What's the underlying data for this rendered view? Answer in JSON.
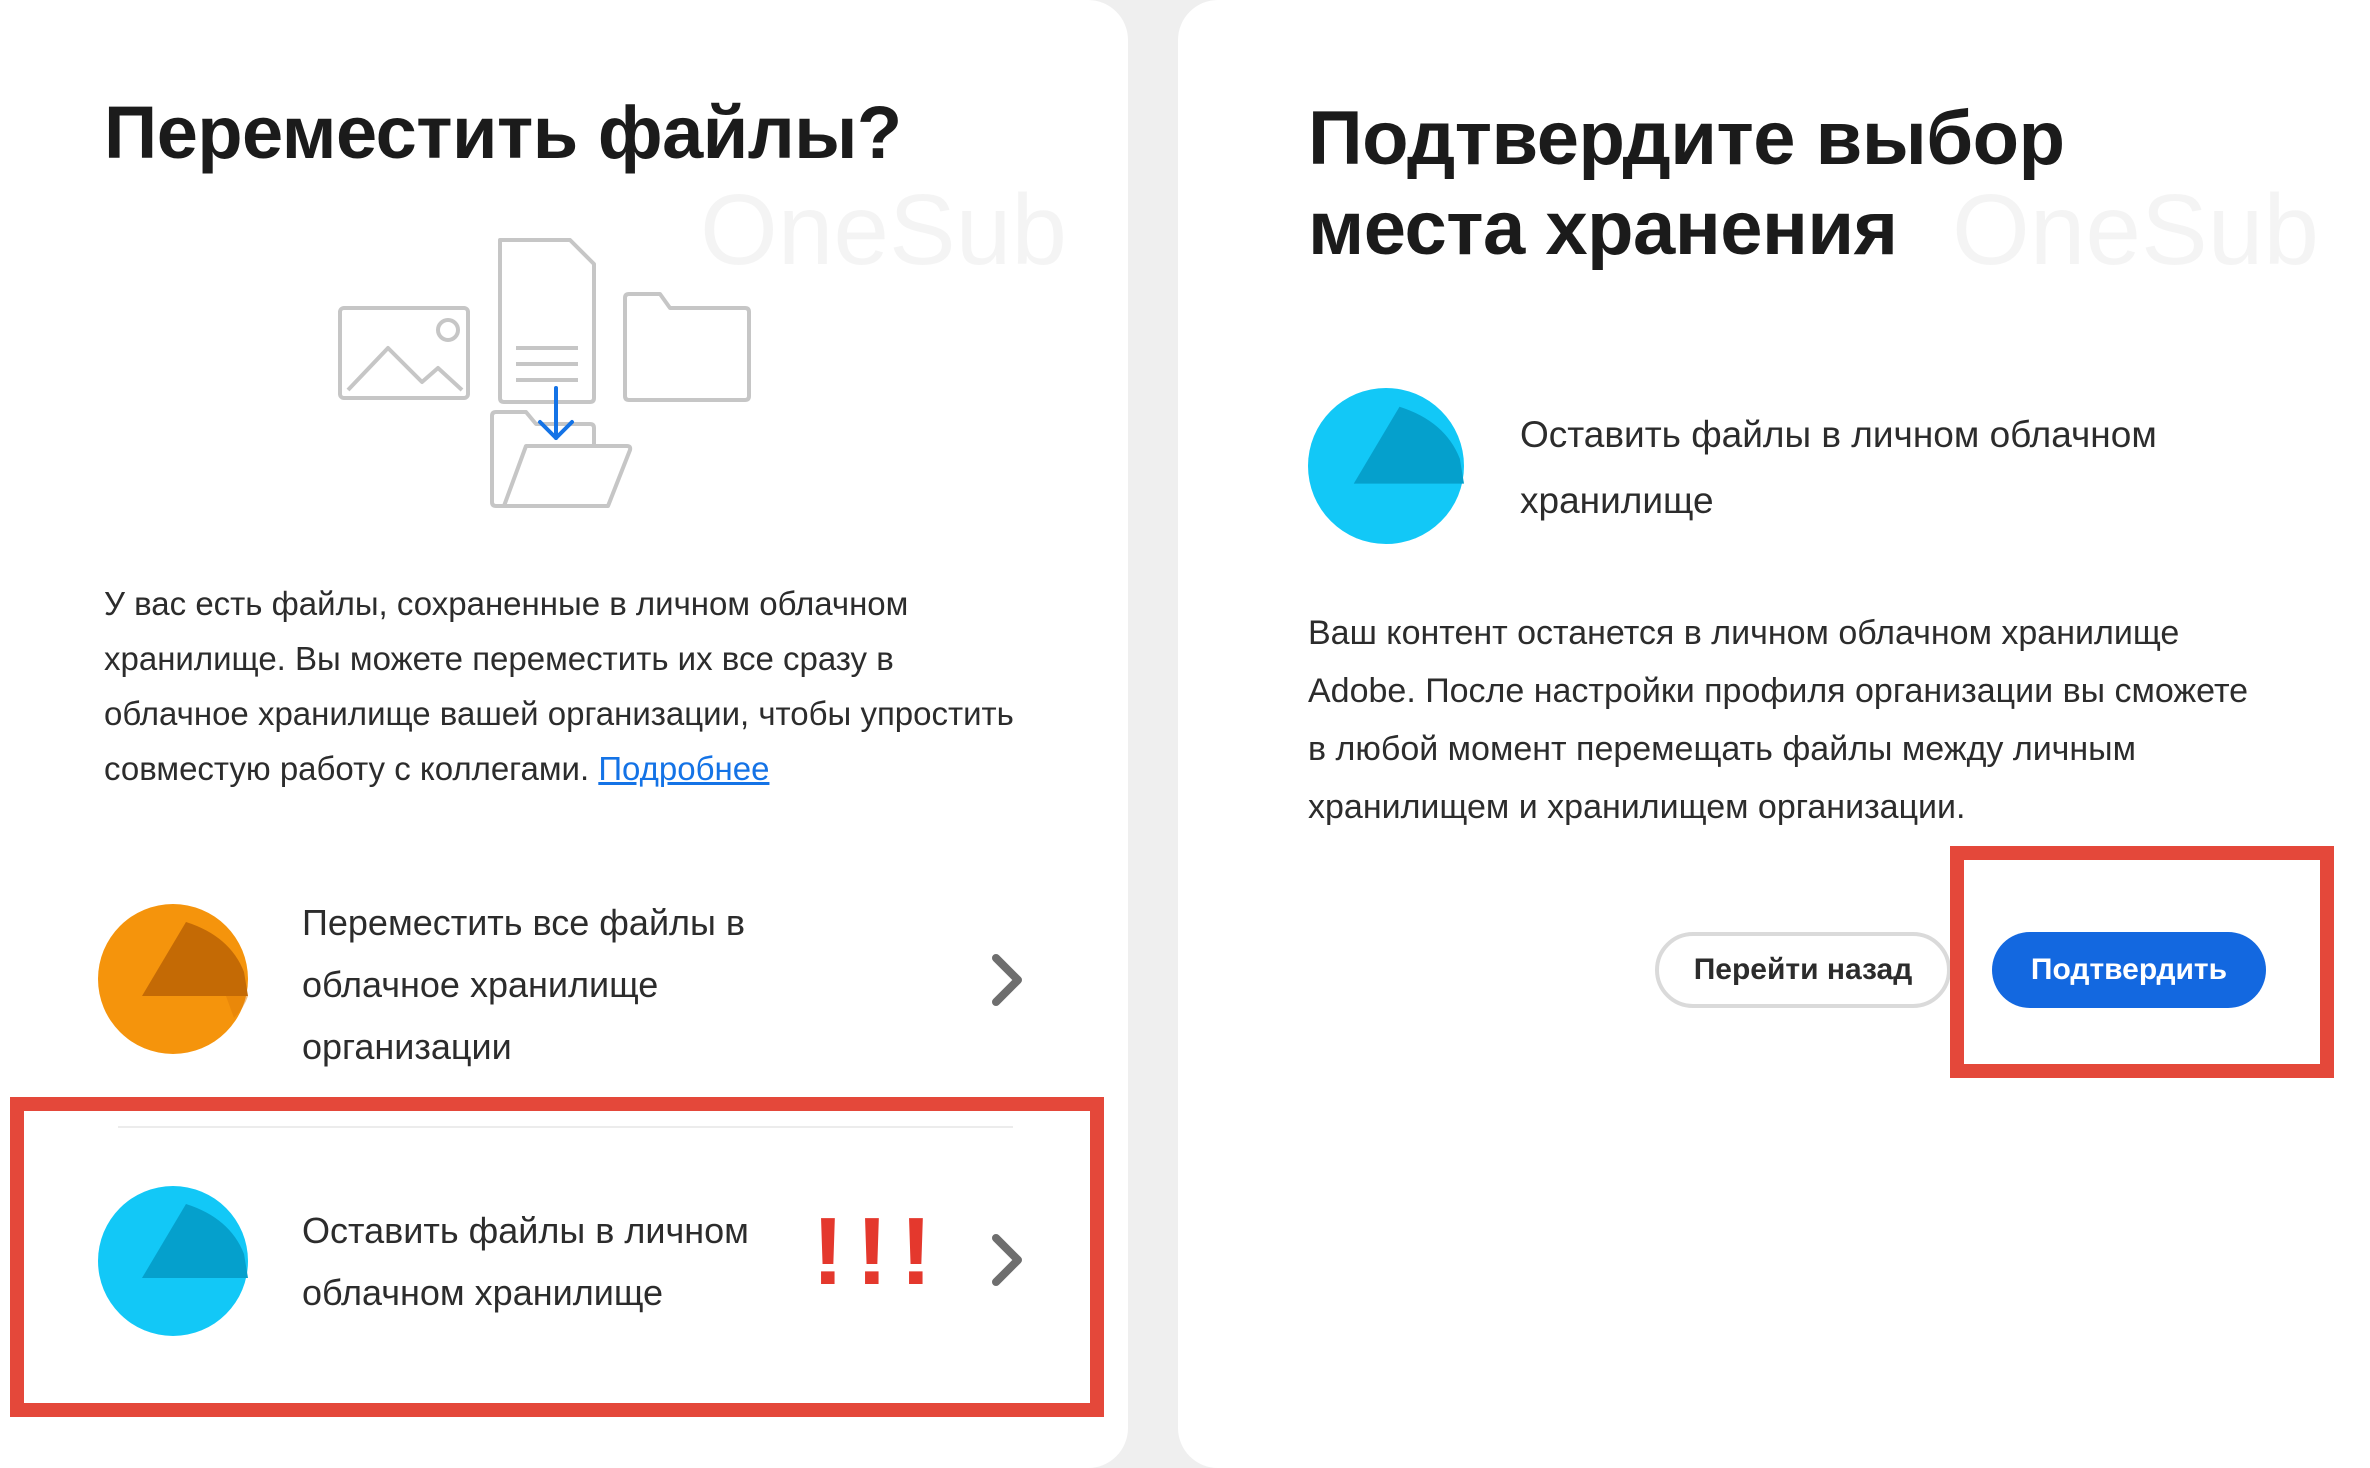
{
  "watermark": "OneSub",
  "left_panel": {
    "title": "Переместить файлы?",
    "description": "У вас есть файлы, сохраненные в личном облачном хранилище. Вы можете переместить их все сразу в облачное хранилище вашей организации, чтобы упростить совместую работу с коллегами.",
    "learn_more": "Подробнее",
    "options": [
      {
        "label": "Переместить все файлы в облачное хранилище организации",
        "icon": "org-cloud-icon",
        "color": "#f5940c"
      },
      {
        "label": "Оставить файлы в личном облачном хранилище",
        "icon": "personal-cloud-icon",
        "color": "#12c8f7"
      }
    ],
    "annotation": "!!!"
  },
  "right_panel": {
    "title_line1": "Подтвердите выбор",
    "title_line2": "места хранения",
    "selected_option": "Оставить файлы в личном облачном хранилище",
    "description": "Ваш контент останется в личном облачном хранилище Adobe. После настройки профиля организации вы сможете в любой момент перемещать файлы между личным хранилищем и хранилищем организации.",
    "back_label": "Перейти назад",
    "confirm_label": "Подтвердить"
  },
  "colors": {
    "accent_blue": "#1368e0",
    "link_blue": "#1473e6",
    "highlight_red": "#e4483a",
    "orange": "#f5940c",
    "cyan": "#12c8f7"
  }
}
